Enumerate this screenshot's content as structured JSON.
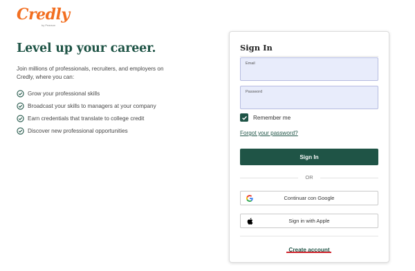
{
  "brand": {
    "name": "Credly",
    "byline": "by Pearson",
    "color": "#f26f21"
  },
  "hero": {
    "title": "Level up your career.",
    "intro": "Join millions of professionals, recruiters, and employers on Credly, where you can:",
    "benefits": [
      "Grow your professional skills",
      "Broadcast your skills to managers at your company",
      "Earn credentials that translate to college credit",
      "Discover new professional opportunities"
    ],
    "accent": "#1f5446"
  },
  "signin": {
    "title": "Sign In",
    "email_label": "Email",
    "email_value": "",
    "password_label": "Password",
    "password_value": "",
    "remember_label": "Remember me",
    "remember_checked": true,
    "forgot_label": "Forgot your password?",
    "submit_label": "Sign In",
    "divider": "OR",
    "google_label": "Continuar con Google",
    "apple_label": "Sign in with Apple",
    "create_label": "Create account"
  },
  "icons": {
    "benefit": "check-circle-icon",
    "remember": "checkmark-icon",
    "google": "google-icon",
    "apple": "apple-icon"
  }
}
